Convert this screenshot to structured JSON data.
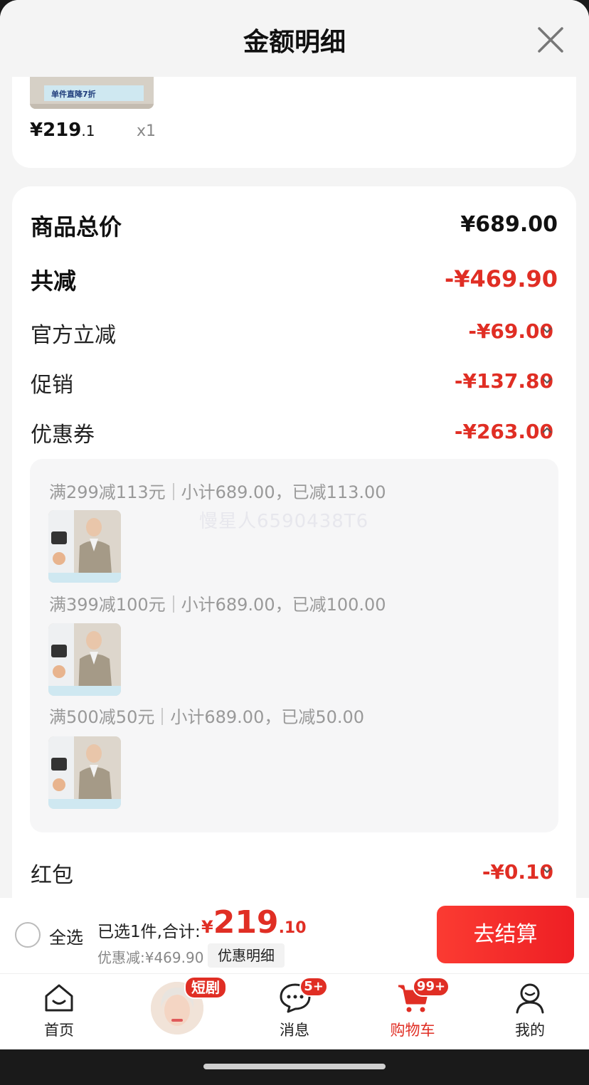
{
  "sheet": {
    "title": "金额明细"
  },
  "top_item": {
    "price_main": "¥219",
    "price_dec": ".1",
    "qty": "x1"
  },
  "summary": {
    "total_label": "商品总价",
    "total_value": "¥689.00",
    "reduce_label": "共减",
    "reduce_value": "-¥469.90",
    "rows": [
      {
        "label": "官方立减",
        "value": "-¥69.00"
      },
      {
        "label": "促销",
        "value": "-¥137.80"
      },
      {
        "label": "优惠券",
        "value": "-¥263.00"
      },
      {
        "label": "红包",
        "value": "-¥0.10"
      }
    ]
  },
  "coupons": [
    {
      "rule": "满299减113元",
      "detail": "小计689.00，已减113.00"
    },
    {
      "rule": "满399减100元",
      "detail": "小计689.00，已减100.00"
    },
    {
      "rule": "满500减50元",
      "detail": "小计689.00，已减50.00"
    }
  ],
  "watermark": "慢星人6590438T6",
  "bottom": {
    "select_all": "全选",
    "selected_text": "已选1件,合计:",
    "total_cur": "¥",
    "total_int": "219",
    "total_dec": ".10",
    "saved": "优惠减:¥469.90",
    "detail_btn": "优惠明细",
    "checkout": "去结算"
  },
  "tabs": [
    {
      "label": "首页",
      "icon": "home-icon"
    },
    {
      "label": "",
      "icon": "avatar",
      "badge": "短剧"
    },
    {
      "label": "消息",
      "icon": "message-icon",
      "badge": "5+"
    },
    {
      "label": "购物车",
      "icon": "cart-icon",
      "badge": "99+"
    },
    {
      "label": "我的",
      "icon": "user-icon"
    }
  ],
  "colors": {
    "accent": "#e02e24",
    "background": "#f4f4f4"
  }
}
